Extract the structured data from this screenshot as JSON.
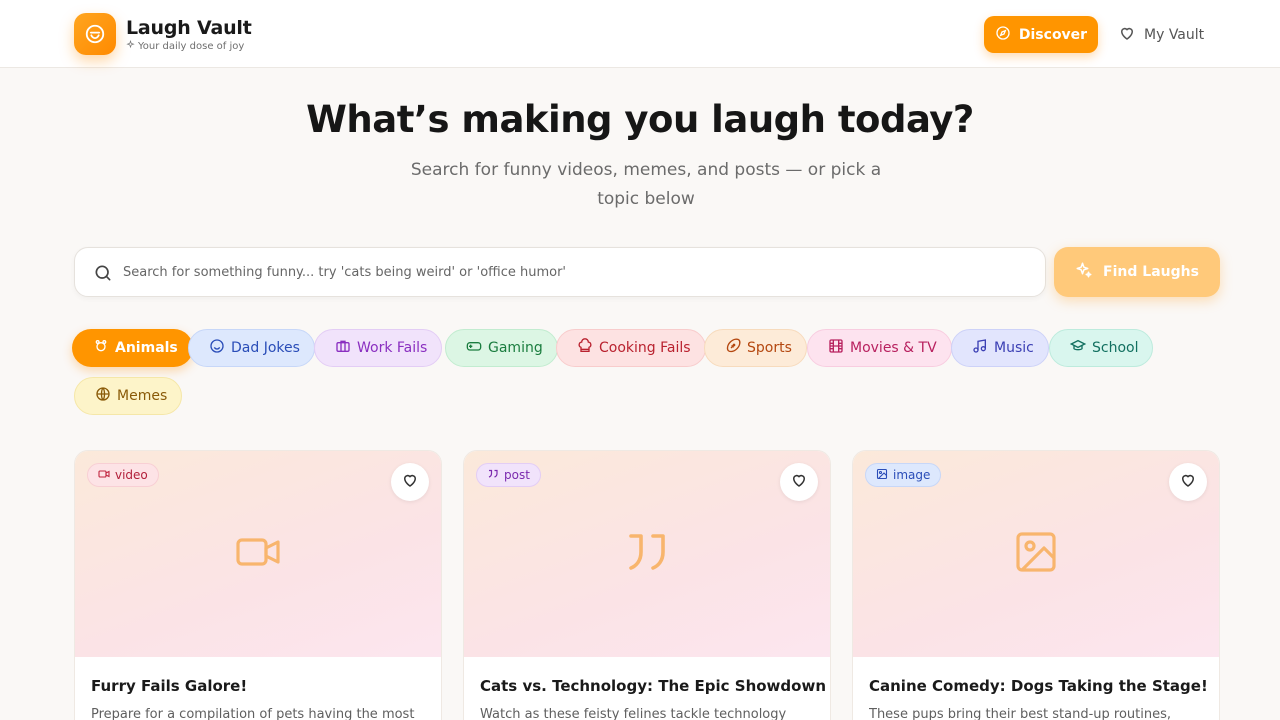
{
  "brand": {
    "title": "Laugh Vault",
    "tagline": "Your daily dose of joy",
    "accent": "#ff9500"
  },
  "nav": {
    "discover_label": "Discover",
    "vault_label": "My Vault"
  },
  "hero": {
    "title": "What’s making you laugh today?",
    "subtitle": "Search for funny videos, memes, and posts — or pick a topic below"
  },
  "search": {
    "placeholder": "Search for something funny... try 'cats being weird' or 'office humor'",
    "value": "",
    "button_label": "Find Laughs"
  },
  "topics": [
    {
      "label": "Animals",
      "icon": "paw-icon",
      "active": true
    },
    {
      "label": "Dad Jokes",
      "icon": "smile-icon"
    },
    {
      "label": "Work Fails",
      "icon": "briefcase-icon"
    },
    {
      "label": "Gaming",
      "icon": "gamepad-icon"
    },
    {
      "label": "Cooking Fails",
      "icon": "chef-hat-icon"
    },
    {
      "label": "Sports",
      "icon": "football-icon"
    },
    {
      "label": "Movies & TV",
      "icon": "film-icon"
    },
    {
      "label": "Music",
      "icon": "music-icon"
    },
    {
      "label": "School",
      "icon": "graduation-cap-icon"
    },
    {
      "label": "Memes",
      "icon": "globe-icon"
    }
  ],
  "cards": [
    {
      "type": "video",
      "type_icon": "video-icon",
      "title": "Furry Fails Galore!",
      "description": "Prepare for a compilation of pets having the most"
    },
    {
      "type": "post",
      "type_icon": "quote-icon",
      "title": "Cats vs. Technology: The Epic Showdown",
      "description": "Watch as these feisty felines tackle technology"
    },
    {
      "type": "image",
      "type_icon": "image-icon",
      "title": "Canine Comedy: Dogs Taking the Stage!",
      "description": "These pups bring their best stand-up routines,"
    }
  ]
}
